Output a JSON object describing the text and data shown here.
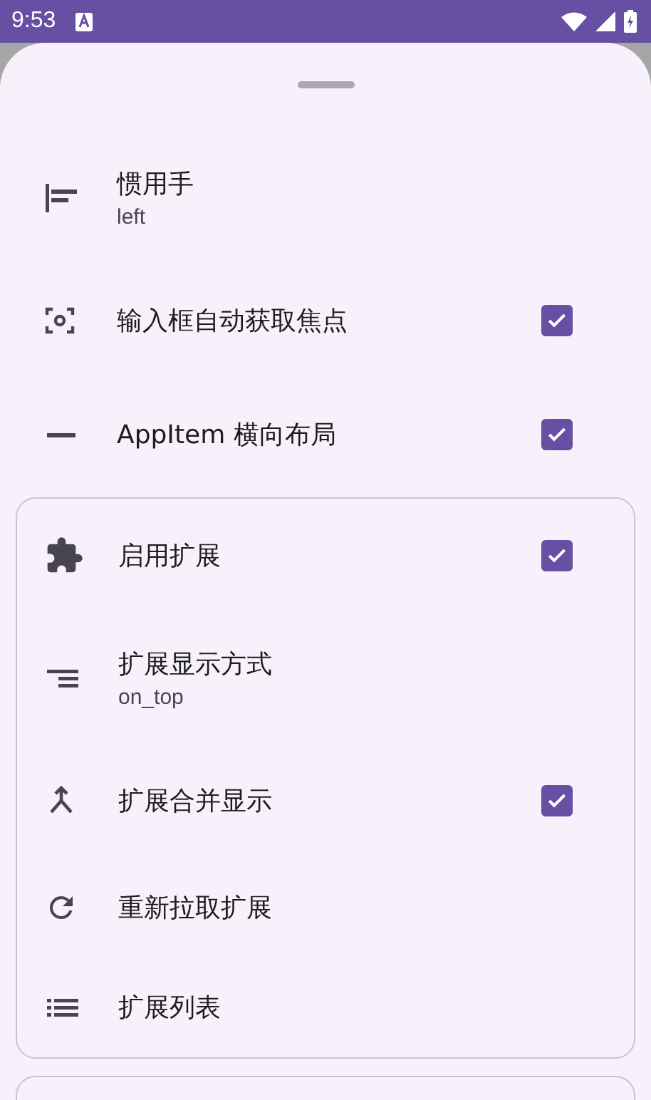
{
  "status_bar": {
    "time": "9:53"
  },
  "settings": [
    {
      "kind": "value",
      "title": "惯用手",
      "value": "left"
    },
    {
      "kind": "checkbox",
      "title": "输入框自动获取焦点",
      "checked": true
    },
    {
      "kind": "checkbox",
      "title": "AppItem 横向布局",
      "checked": true
    }
  ],
  "extension_card": [
    {
      "kind": "checkbox",
      "title": "启用扩展",
      "checked": true
    },
    {
      "kind": "value",
      "title": "扩展显示方式",
      "value": "on_top"
    },
    {
      "kind": "checkbox",
      "title": "扩展合并显示",
      "checked": true
    },
    {
      "kind": "action",
      "title": "重新拉取扩展"
    },
    {
      "kind": "action",
      "title": "扩展列表"
    }
  ]
}
